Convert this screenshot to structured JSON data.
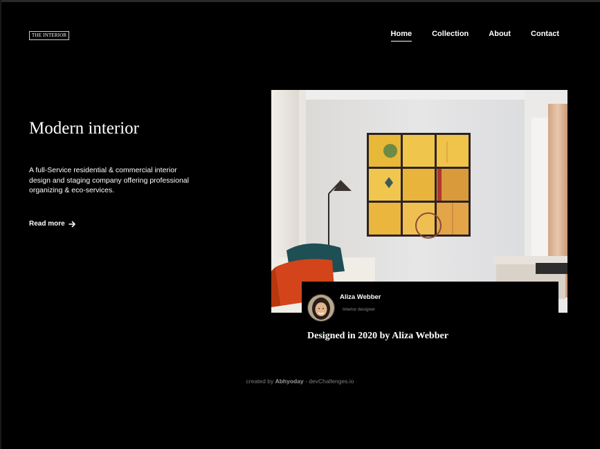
{
  "header": {
    "logo": "THE INTERIOR",
    "nav": [
      {
        "label": "Home",
        "active": true
      },
      {
        "label": "Collection",
        "active": false
      },
      {
        "label": "About",
        "active": false
      },
      {
        "label": "Contact",
        "active": false
      }
    ]
  },
  "hero": {
    "title": "Modern interior",
    "description": "A full-Service residential & commercial interior design and staging company offering professional organizing & eco-services.",
    "read_more": "Read more",
    "arrow_icon": "arrow-right-icon"
  },
  "designer": {
    "name": "Aliza Webber",
    "role": "Interior designer",
    "caption": "Designed in 2020 by Aliza Webber"
  },
  "footer": {
    "prefix": "created by",
    "author": "Abhyoday",
    "suffix": "- devChallenges.io"
  },
  "colors": {
    "background": "#000000",
    "text": "#ffffff",
    "muted": "#7d7d7d"
  }
}
